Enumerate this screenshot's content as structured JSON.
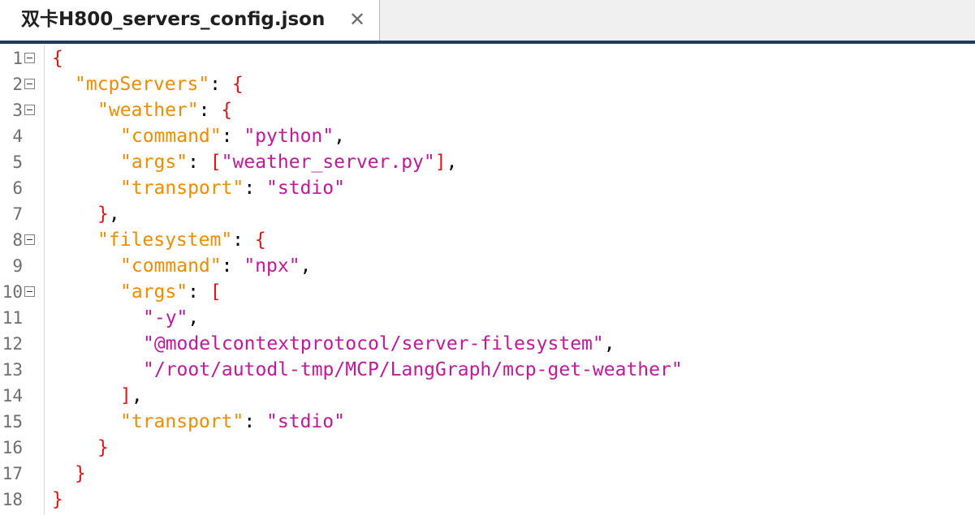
{
  "tab": {
    "title": "双卡H800_servers_config.json",
    "close_glyph": "✕"
  },
  "colors": {
    "brace": "#e01616",
    "key": "#f08c00",
    "string": "#c2189c",
    "punctuation": "#000000",
    "line_number": "#6e6e6e"
  },
  "lines": [
    {
      "n": "1",
      "foldable": true,
      "indent": 0,
      "tokens": [
        {
          "t": "brace",
          "v": "{"
        }
      ]
    },
    {
      "n": "2",
      "foldable": true,
      "indent": 1,
      "tokens": [
        {
          "t": "key",
          "v": "\"mcpServers\""
        },
        {
          "t": "punct",
          "v": ": "
        },
        {
          "t": "brace",
          "v": "{"
        }
      ]
    },
    {
      "n": "3",
      "foldable": true,
      "indent": 2,
      "tokens": [
        {
          "t": "key",
          "v": "\"weather\""
        },
        {
          "t": "punct",
          "v": ": "
        },
        {
          "t": "brace",
          "v": "{"
        }
      ]
    },
    {
      "n": "4",
      "foldable": false,
      "indent": 3,
      "tokens": [
        {
          "t": "key",
          "v": "\"command\""
        },
        {
          "t": "punct",
          "v": ": "
        },
        {
          "t": "str",
          "v": "\"python\""
        },
        {
          "t": "punct",
          "v": ","
        }
      ]
    },
    {
      "n": "5",
      "foldable": false,
      "indent": 3,
      "tokens": [
        {
          "t": "key",
          "v": "\"args\""
        },
        {
          "t": "punct",
          "v": ": "
        },
        {
          "t": "brace",
          "v": "["
        },
        {
          "t": "str",
          "v": "\"weather_server.py\""
        },
        {
          "t": "brace",
          "v": "]"
        },
        {
          "t": "punct",
          "v": ","
        }
      ]
    },
    {
      "n": "6",
      "foldable": false,
      "indent": 3,
      "tokens": [
        {
          "t": "key",
          "v": "\"transport\""
        },
        {
          "t": "punct",
          "v": ": "
        },
        {
          "t": "str",
          "v": "\"stdio\""
        }
      ]
    },
    {
      "n": "7",
      "foldable": false,
      "indent": 2,
      "tokens": [
        {
          "t": "brace",
          "v": "}"
        },
        {
          "t": "punct",
          "v": ","
        }
      ]
    },
    {
      "n": "8",
      "foldable": true,
      "indent": 2,
      "tokens": [
        {
          "t": "key",
          "v": "\"filesystem\""
        },
        {
          "t": "punct",
          "v": ": "
        },
        {
          "t": "brace",
          "v": "{"
        }
      ]
    },
    {
      "n": "9",
      "foldable": false,
      "indent": 3,
      "tokens": [
        {
          "t": "key",
          "v": "\"command\""
        },
        {
          "t": "punct",
          "v": ": "
        },
        {
          "t": "str",
          "v": "\"npx\""
        },
        {
          "t": "punct",
          "v": ","
        }
      ]
    },
    {
      "n": "10",
      "foldable": true,
      "indent": 3,
      "tokens": [
        {
          "t": "key",
          "v": "\"args\""
        },
        {
          "t": "punct",
          "v": ": "
        },
        {
          "t": "brace",
          "v": "["
        }
      ]
    },
    {
      "n": "11",
      "foldable": false,
      "indent": 4,
      "tokens": [
        {
          "t": "str",
          "v": "\"-y\""
        },
        {
          "t": "punct",
          "v": ","
        }
      ]
    },
    {
      "n": "12",
      "foldable": false,
      "indent": 4,
      "tokens": [
        {
          "t": "str",
          "v": "\"@modelcontextprotocol/server-filesystem\""
        },
        {
          "t": "punct",
          "v": ","
        }
      ]
    },
    {
      "n": "13",
      "foldable": false,
      "indent": 4,
      "tokens": [
        {
          "t": "str",
          "v": "\"/root/autodl-tmp/MCP/LangGraph/mcp-get-weather\""
        }
      ]
    },
    {
      "n": "14",
      "foldable": false,
      "indent": 3,
      "tokens": [
        {
          "t": "brace",
          "v": "]"
        },
        {
          "t": "punct",
          "v": ","
        }
      ]
    },
    {
      "n": "15",
      "foldable": false,
      "indent": 3,
      "tokens": [
        {
          "t": "key",
          "v": "\"transport\""
        },
        {
          "t": "punct",
          "v": ": "
        },
        {
          "t": "str",
          "v": "\"stdio\""
        }
      ]
    },
    {
      "n": "16",
      "foldable": false,
      "indent": 2,
      "tokens": [
        {
          "t": "brace",
          "v": "}"
        }
      ]
    },
    {
      "n": "17",
      "foldable": false,
      "indent": 1,
      "tokens": [
        {
          "t": "brace",
          "v": "}"
        }
      ]
    },
    {
      "n": "18",
      "foldable": false,
      "indent": 0,
      "tokens": [
        {
          "t": "brace",
          "v": "}"
        }
      ]
    }
  ]
}
